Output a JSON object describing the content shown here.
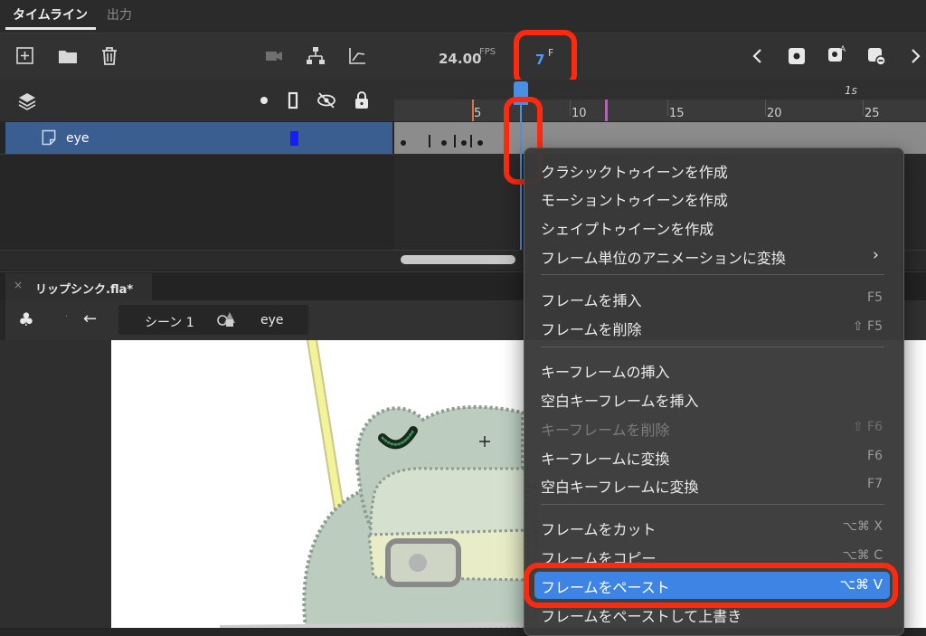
{
  "tabs": {
    "timeline": "タイムライン",
    "output": "出力"
  },
  "toolbar": {
    "fps_value": "24.00",
    "fps_label": "FPS",
    "frame_value": "7",
    "frame_label": "F"
  },
  "ruler": {
    "labels": [
      "5",
      "10",
      "15",
      "20",
      "25"
    ],
    "seconds": "1s"
  },
  "layer": {
    "name": "eye",
    "color": "#1a1aff"
  },
  "document": {
    "title": "リップシンク.fla*",
    "close": "×"
  },
  "scene": {
    "back": "←",
    "scene_name": "シーン 1",
    "symbol_name": "eye"
  },
  "menu": {
    "items": [
      {
        "label": "クラシックトゥイーンを作成",
        "shortcut": ""
      },
      {
        "label": "モーショントゥイーンを作成",
        "shortcut": ""
      },
      {
        "label": "シェイプトゥイーンを作成",
        "shortcut": ""
      },
      {
        "label": "フレーム単位のアニメーションに変換",
        "shortcut": ""
      },
      {
        "label": "フレームを挿入",
        "shortcut": "F5"
      },
      {
        "label": "フレームを削除",
        "shortcut": "⇧ F5"
      },
      {
        "label": "キーフレームの挿入",
        "shortcut": ""
      },
      {
        "label": "空白キーフレームを挿入",
        "shortcut": ""
      },
      {
        "label": "キーフレームを削除",
        "shortcut": "⇧ F6"
      },
      {
        "label": "キーフレームに変換",
        "shortcut": "F6"
      },
      {
        "label": "空白キーフレームに変換",
        "shortcut": "F7"
      },
      {
        "label": "フレームをカット",
        "shortcut": "⌥⌘ X"
      },
      {
        "label": "フレームをコピー",
        "shortcut": "⌥⌘ C"
      },
      {
        "label": "フレームをペースト",
        "shortcut": "⌥⌘ V"
      },
      {
        "label": "フレームをペーストして上書き",
        "shortcut": ""
      }
    ]
  },
  "colors": {
    "accent": "#3d84e4",
    "callout": "#ff2a0e",
    "layer_row": "#3b5e91",
    "playhead": "#4a8fe0"
  }
}
